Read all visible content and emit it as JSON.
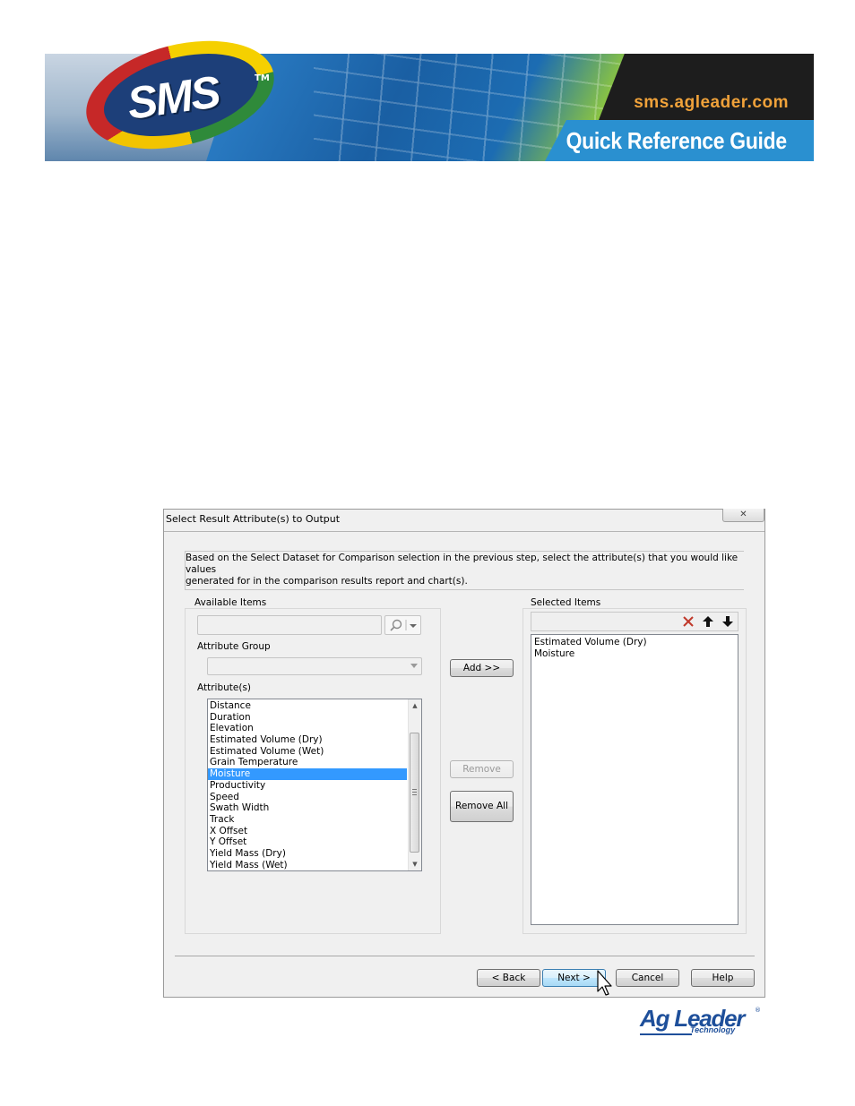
{
  "banner": {
    "logo_text": "SMS",
    "logo_tm": "TM",
    "url": "sms.agleader.com",
    "guide_title": "Quick Reference Guide"
  },
  "dialog": {
    "title": "Select Result Attribute(s) to Output",
    "close_glyph": "✕",
    "description_line1": "Based on the Select Dataset for Comparison selection in the previous step, select the attribute(s) that you would like values",
    "description_line2": "generated for in the comparison results report and chart(s).",
    "available": {
      "group_label": "Available Items",
      "search_value": "",
      "attribute_group_label": "Attribute Group",
      "attribute_group_value": "",
      "attributes_label": "Attribute(s)",
      "items": [
        "Distance",
        "Duration",
        "Elevation",
        "Estimated Volume (Dry)",
        "Estimated Volume (Wet)",
        "Grain Temperature",
        "Moisture",
        "Productivity",
        "Speed",
        "Swath Width",
        "Track",
        "X Offset",
        "Y Offset",
        "Yield Mass (Dry)",
        "Yield Mass (Wet)"
      ],
      "selected_item": "Moisture"
    },
    "buttons": {
      "add": "Add >>",
      "remove": "Remove",
      "remove_all": "Remove All",
      "back": "< Back",
      "next": "Next >",
      "cancel": "Cancel",
      "help": "Help"
    },
    "selected": {
      "group_label": "Selected Items",
      "items": [
        "Estimated Volume (Dry)",
        "Moisture"
      ]
    },
    "icons": {
      "delete": "delete-x-icon",
      "move_up": "arrow-up-icon",
      "move_down": "arrow-down-icon",
      "search": "search-icon"
    },
    "colors": {
      "selection": "#3399ff",
      "delete_icon": "#c0392b"
    }
  },
  "footer": {
    "brand_main": "Ag Leader",
    "brand_sub": "Technology",
    "brand_reg": "®"
  }
}
